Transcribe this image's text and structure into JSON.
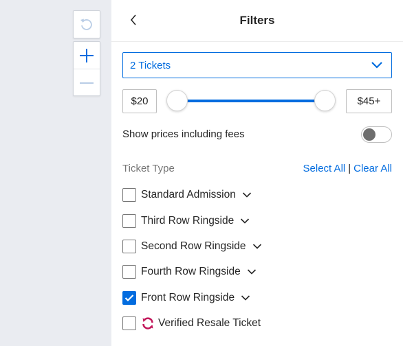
{
  "header": {
    "title": "Filters"
  },
  "quantity": {
    "selected": "2 Tickets"
  },
  "price": {
    "min_label": "$20",
    "max_label": "$45+"
  },
  "fees": {
    "label": "Show prices including fees",
    "enabled": false
  },
  "ticket_type": {
    "heading": "Ticket Type",
    "select_all": "Select All",
    "separator": "|",
    "clear_all": "Clear All",
    "options": [
      {
        "label": "Standard Admission",
        "checked": false
      },
      {
        "label": "Third Row Ringside",
        "checked": false
      },
      {
        "label": "Second Row Ringside",
        "checked": false
      },
      {
        "label": "Fourth Row Ringside",
        "checked": false
      },
      {
        "label": "Front Row Ringside",
        "checked": true
      },
      {
        "label": "Verified Resale Ticket",
        "checked": false
      }
    ]
  },
  "colors": {
    "accent": "#026cdf",
    "resale": "#c2185b",
    "text": "#262626",
    "muted": "#767676"
  }
}
